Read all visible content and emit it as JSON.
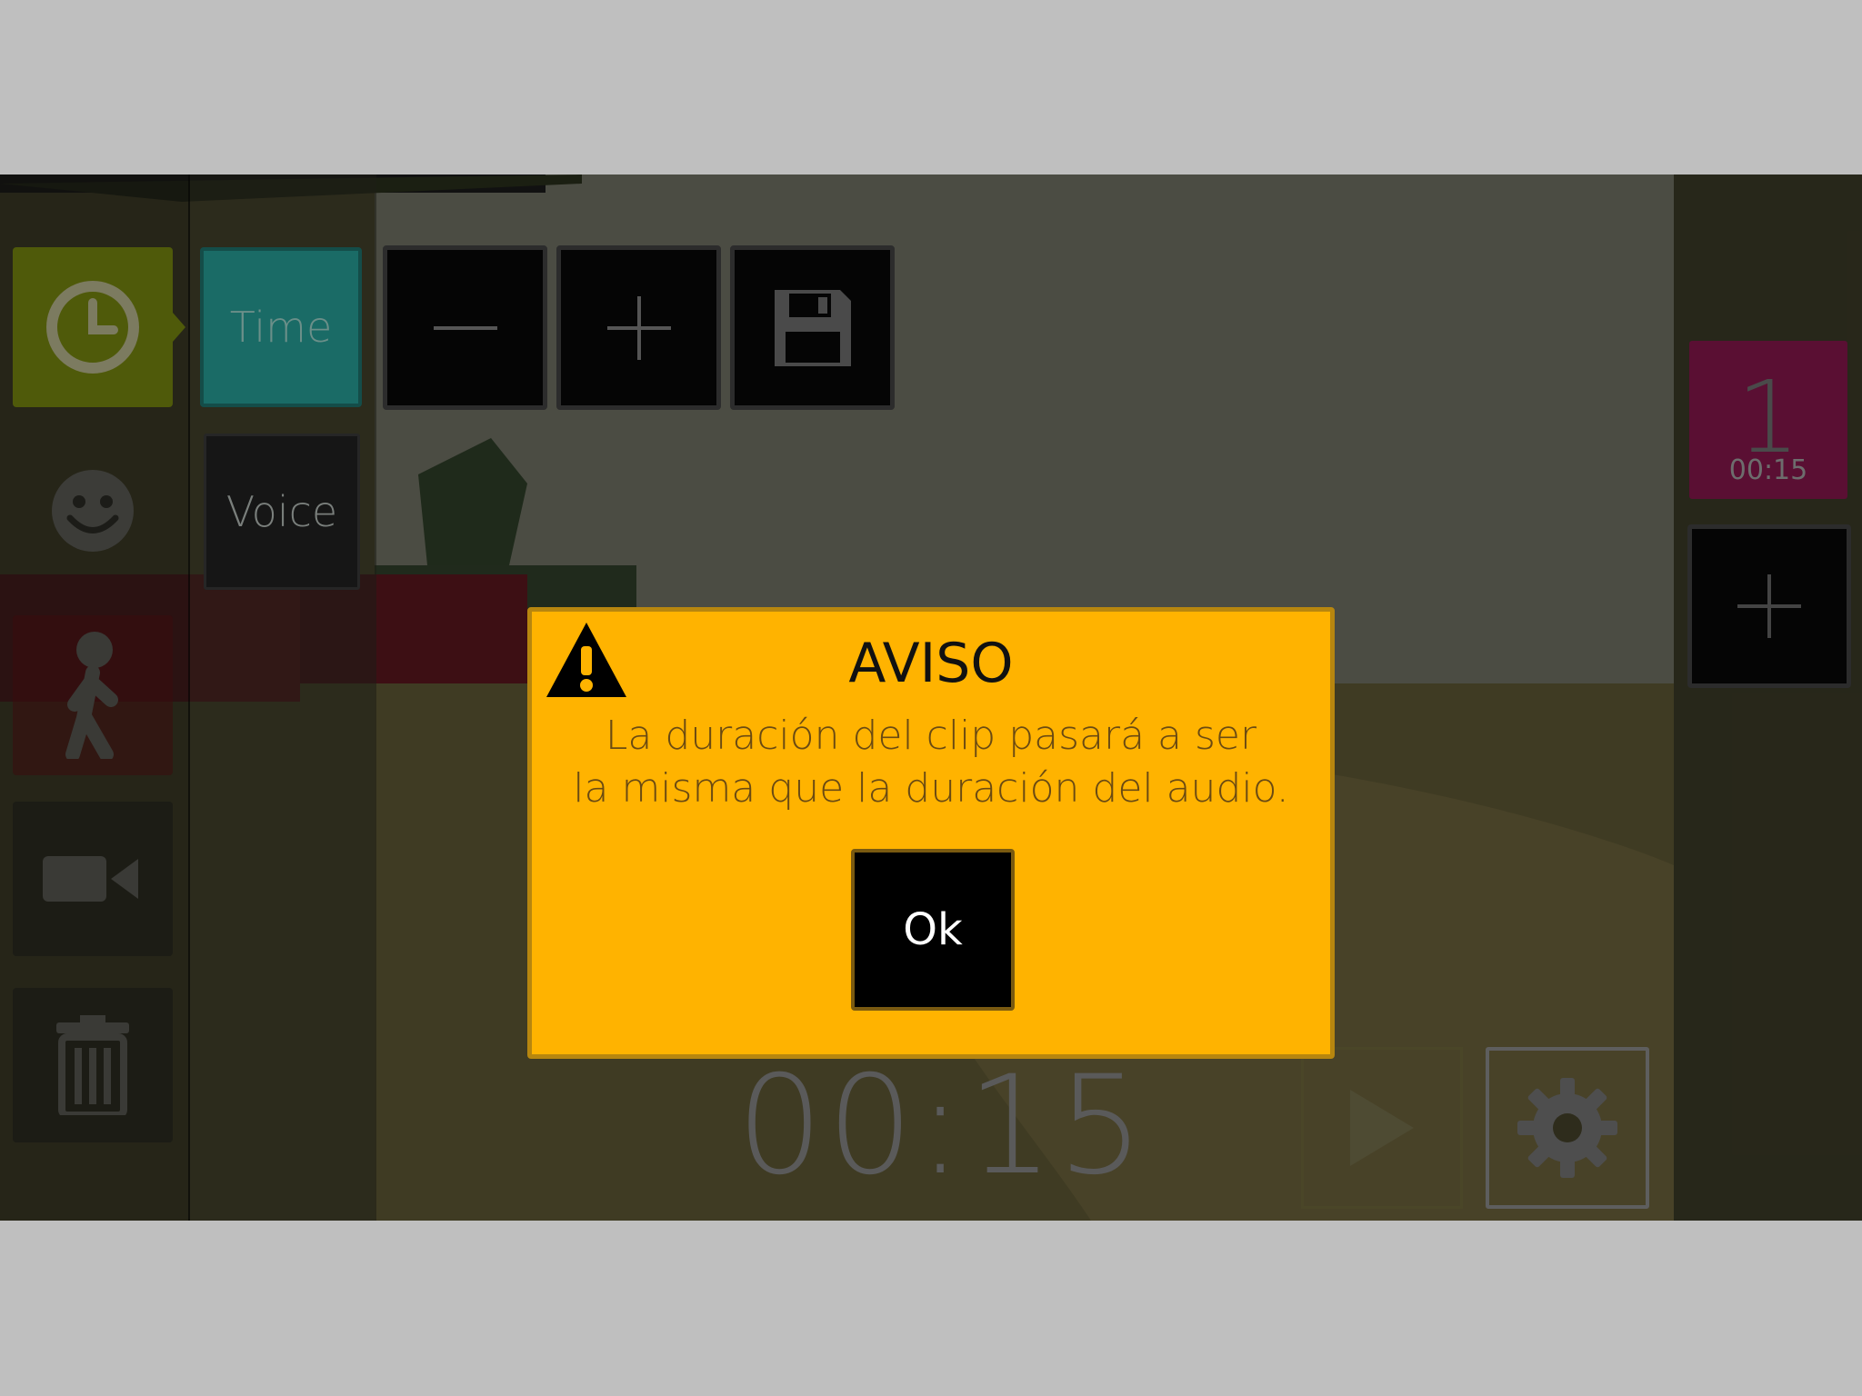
{
  "toolbar": {
    "time_label": "Time",
    "voice_label": "Voice"
  },
  "icons": {
    "clock": "clock-icon",
    "face": "smiley-icon",
    "walk": "walking-person-icon",
    "camera": "video-camera-icon",
    "trash": "trash-icon",
    "minus": "minus-icon",
    "plus": "plus-icon",
    "save": "floppy-disk-icon",
    "play": "play-icon",
    "settings": "gear-icon",
    "warning": "warning-icon"
  },
  "timer": "00:15",
  "clip": {
    "number": "1",
    "duration": "00:15"
  },
  "dialog": {
    "title": "AVISO",
    "message_line1": "La duración del clip pasará a ser",
    "message_line2": "la misma que la duración del audio.",
    "ok_label": "Ok"
  },
  "colors": {
    "dialog_bg": "#ffb300",
    "time_tab": "#1a6b66",
    "clock_tile": "#4f5a0a",
    "clip_card": "#5a0f33"
  }
}
